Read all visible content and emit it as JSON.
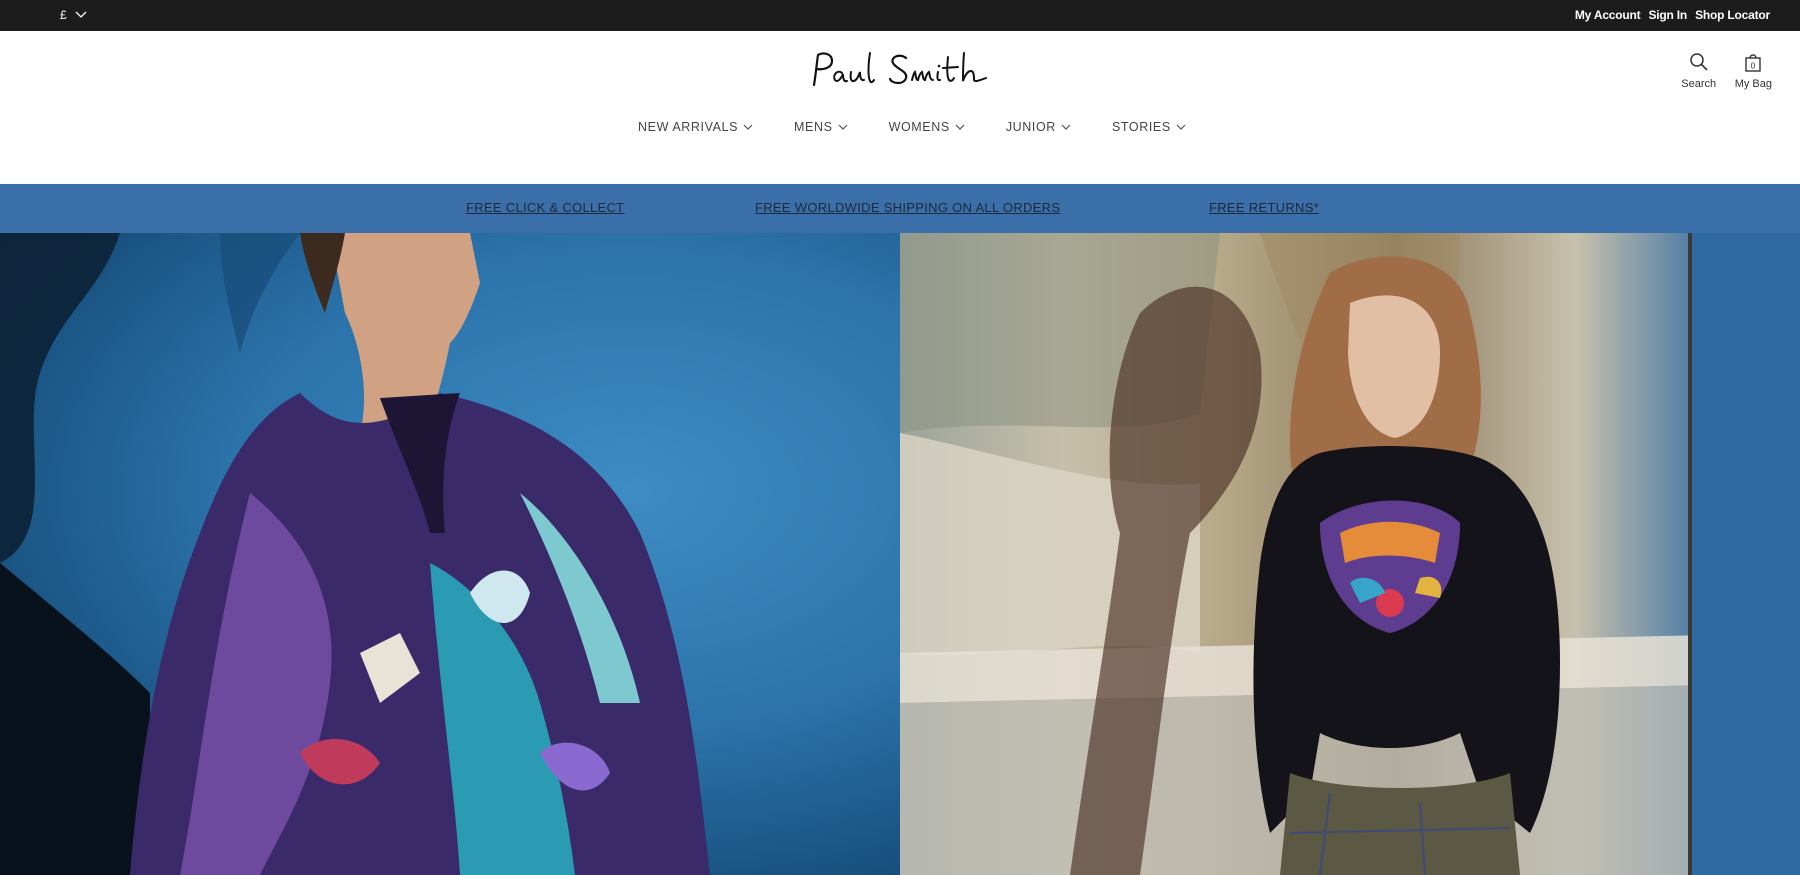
{
  "topbar": {
    "currency": "£",
    "links": {
      "my_account": "My Account",
      "sign_in": "Sign In",
      "shop_locator": "Shop Locator"
    }
  },
  "header": {
    "brand_name": "Paul Smith",
    "search_label": "Search",
    "bag_label": "My Bag",
    "bag_count": "0"
  },
  "nav": {
    "new_arrivals": "NEW ARRIVALS",
    "mens": "MENS",
    "womens": "WOMENS",
    "junior": "JUNIOR",
    "stories": "STORIES"
  },
  "promo": {
    "click_collect": "FREE CLICK & COLLECT",
    "shipping": "FREE WORLDWIDE SHIPPING ON ALL ORDERS",
    "returns": "FREE RETURNS*"
  },
  "colors": {
    "topbar_bg": "#1c1c1c",
    "promo_bg": "#3a6fa9",
    "promo_text": "#1d2a3c"
  },
  "hero": {
    "left_image": "mens-printed-shirt-photo",
    "right_image": "womens-embroidered-sweatshirt-photo"
  }
}
